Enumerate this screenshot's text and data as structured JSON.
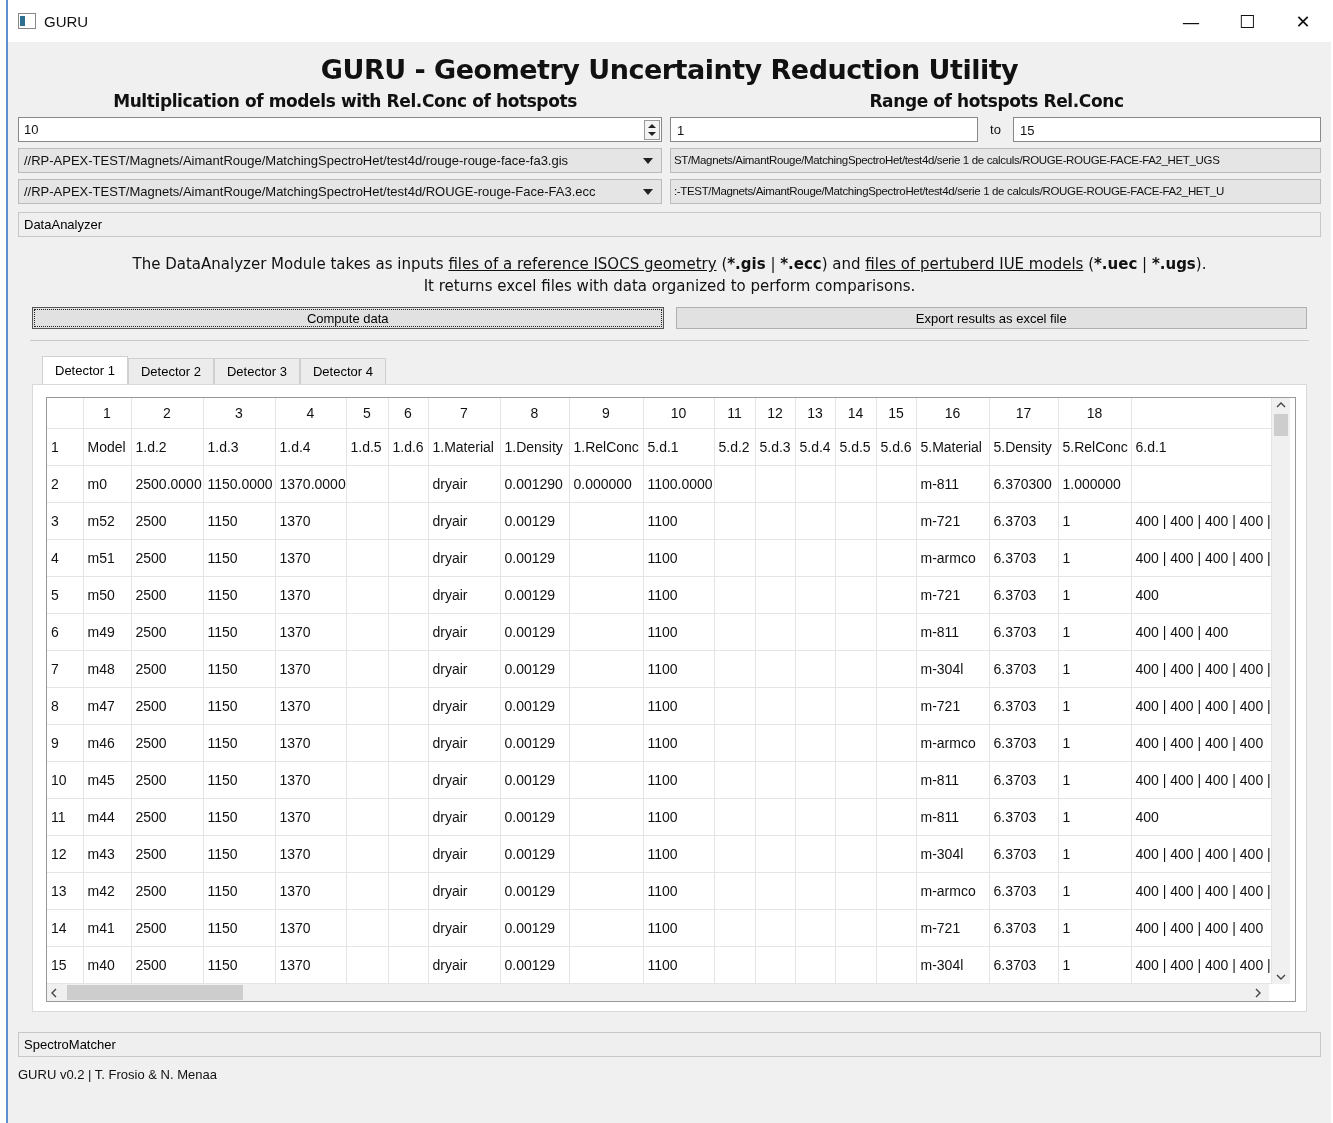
{
  "window": {
    "title": "GURU",
    "controls": [
      "—",
      "☐",
      "✕"
    ]
  },
  "app_title": "GURU -  Geometry Uncertainty Reduction Utility",
  "multiplication": {
    "heading": "Multiplication of models with Rel.Conc of hotspots",
    "value": "10"
  },
  "range": {
    "heading": "Range of hotspots Rel.Conc",
    "from": "1",
    "separator": "to",
    "to": "15"
  },
  "reference_files": [
    {
      "value": "//RP-APEX-TEST/Magnets/AimantRouge/MatchingSpectroHet/test4d/rouge-rouge-face-fa3.gis"
    },
    {
      "value": "//RP-APEX-TEST/Magnets/AimantRouge/MatchingSpectroHet/test4d/ROUGE-rouge-Face-FA3.ecc"
    }
  ],
  "model_files": [
    {
      "value": "ST/Magnets/AimantRouge/MatchingSpectroHet/test4d/serie 1 de calculs/ROUGE-ROUGE-FACE-FA2_HET_UGS"
    },
    {
      "value": ":-TEST/Magnets/AimantRouge/MatchingSpectroHet/test4d/serie 1 de calculs/ROUGE-ROUGE-FACE-FA2_HET_U"
    }
  ],
  "data_analyzer": {
    "section": "DataAnalyzer",
    "description": [
      [
        {
          "kind": "text",
          "text": "The DataAnalyzer Module takes as inputs "
        },
        {
          "kind": "link",
          "text": "files of a reference ISOCS geometry"
        },
        {
          "kind": "text",
          "text": " ("
        },
        {
          "kind": "bold",
          "text": "*.gis"
        },
        {
          "kind": "text",
          "text": " | "
        },
        {
          "kind": "bold",
          "text": "*.ecc"
        },
        {
          "kind": "text",
          "text": ") and "
        },
        {
          "kind": "link",
          "text": "files of pertuberd IUE models"
        },
        {
          "kind": "text",
          "text": " ("
        },
        {
          "kind": "bold",
          "text": "*.uec"
        },
        {
          "kind": "text",
          "text": " | "
        },
        {
          "kind": "bold",
          "text": "*.ugs"
        },
        {
          "kind": "text",
          "text": ")."
        }
      ],
      [
        {
          "kind": "text",
          "text": "It returns excel files with data organized to perform comparisons."
        }
      ]
    ],
    "buttons": [
      {
        "label": "Compute data",
        "focused": true
      },
      {
        "label": "Export results as excel file",
        "focused": false
      }
    ],
    "tabs": [
      {
        "label": "Detector 1",
        "selected": true
      },
      {
        "label": "Detector 2",
        "selected": false
      },
      {
        "label": "Detector 3",
        "selected": false
      },
      {
        "label": "Detector 4",
        "selected": false
      }
    ],
    "table": {
      "columns": [
        "1",
        "2",
        "3",
        "4",
        "5",
        "6",
        "7",
        "8",
        "9",
        "10",
        "11",
        "12",
        "13",
        "14",
        "15",
        "16",
        "17",
        "18"
      ],
      "rows": [
        {
          "label": "1",
          "cells": [
            "Model",
            "1.d.2",
            "1.d.3",
            "1.d.4",
            "1.d.5",
            "1.d.6",
            "1.Material",
            "1.Density",
            "1.RelConc",
            "5.d.1",
            "5.d.2",
            "5.d.3",
            "5.d.4",
            "5.d.5",
            "5.d.6",
            "5.Material",
            "5.Density",
            "5.RelConc",
            "6.d.1"
          ]
        },
        {
          "label": "2",
          "cells": [
            "m0",
            "2500.0000",
            "1150.0000",
            "1370.0000",
            null,
            null,
            "dryair",
            "0.001290",
            "0.000000",
            "1100.0000",
            null,
            null,
            null,
            null,
            null,
            "m-811",
            "6.370300",
            "1.000000",
            null
          ]
        },
        {
          "label": "3",
          "cells": [
            "m52",
            "2500",
            "1150",
            "1370",
            null,
            null,
            "dryair",
            "0.00129",
            null,
            "1100",
            null,
            null,
            null,
            null,
            null,
            "m-721",
            "6.3703",
            "1",
            "400 | 400 | 400 | 400 |"
          ]
        },
        {
          "label": "4",
          "cells": [
            "m51",
            "2500",
            "1150",
            "1370",
            null,
            null,
            "dryair",
            "0.00129",
            null,
            "1100",
            null,
            null,
            null,
            null,
            null,
            "m-armco",
            "6.3703",
            "1",
            "400 | 400 | 400 | 400 |"
          ]
        },
        {
          "label": "5",
          "cells": [
            "m50",
            "2500",
            "1150",
            "1370",
            null,
            null,
            "dryair",
            "0.00129",
            null,
            "1100",
            null,
            null,
            null,
            null,
            null,
            "m-721",
            "6.3703",
            "1",
            "400"
          ]
        },
        {
          "label": "6",
          "cells": [
            "m49",
            "2500",
            "1150",
            "1370",
            null,
            null,
            "dryair",
            "0.00129",
            null,
            "1100",
            null,
            null,
            null,
            null,
            null,
            "m-811",
            "6.3703",
            "1",
            "400 | 400 | 400"
          ]
        },
        {
          "label": "7",
          "cells": [
            "m48",
            "2500",
            "1150",
            "1370",
            null,
            null,
            "dryair",
            "0.00129",
            null,
            "1100",
            null,
            null,
            null,
            null,
            null,
            "m-304l",
            "6.3703",
            "1",
            "400 | 400 | 400 | 400 |"
          ]
        },
        {
          "label": "8",
          "cells": [
            "m47",
            "2500",
            "1150",
            "1370",
            null,
            null,
            "dryair",
            "0.00129",
            null,
            "1100",
            null,
            null,
            null,
            null,
            null,
            "m-721",
            "6.3703",
            "1",
            "400 | 400 | 400 | 400 |"
          ]
        },
        {
          "label": "9",
          "cells": [
            "m46",
            "2500",
            "1150",
            "1370",
            null,
            null,
            "dryair",
            "0.00129",
            null,
            "1100",
            null,
            null,
            null,
            null,
            null,
            "m-armco",
            "6.3703",
            "1",
            "400 | 400 | 400 | 400"
          ]
        },
        {
          "label": "10",
          "cells": [
            "m45",
            "2500",
            "1150",
            "1370",
            null,
            null,
            "dryair",
            "0.00129",
            null,
            "1100",
            null,
            null,
            null,
            null,
            null,
            "m-811",
            "6.3703",
            "1",
            "400 | 400 | 400 | 400 |"
          ]
        },
        {
          "label": "11",
          "cells": [
            "m44",
            "2500",
            "1150",
            "1370",
            null,
            null,
            "dryair",
            "0.00129",
            null,
            "1100",
            null,
            null,
            null,
            null,
            null,
            "m-811",
            "6.3703",
            "1",
            "400"
          ]
        },
        {
          "label": "12",
          "cells": [
            "m43",
            "2500",
            "1150",
            "1370",
            null,
            null,
            "dryair",
            "0.00129",
            null,
            "1100",
            null,
            null,
            null,
            null,
            null,
            "m-304l",
            "6.3703",
            "1",
            "400 | 400 | 400 | 400 |"
          ]
        },
        {
          "label": "13",
          "cells": [
            "m42",
            "2500",
            "1150",
            "1370",
            null,
            null,
            "dryair",
            "0.00129",
            null,
            "1100",
            null,
            null,
            null,
            null,
            null,
            "m-armco",
            "6.3703",
            "1",
            "400 | 400 | 400 | 400 |"
          ]
        },
        {
          "label": "14",
          "cells": [
            "m41",
            "2500",
            "1150",
            "1370",
            null,
            null,
            "dryair",
            "0.00129",
            null,
            "1100",
            null,
            null,
            null,
            null,
            null,
            "m-721",
            "6.3703",
            "1",
            "400 | 400 | 400 | 400"
          ]
        },
        {
          "label": "15",
          "cells": [
            "m40",
            "2500",
            "1150",
            "1370",
            null,
            null,
            "dryair",
            "0.00129",
            null,
            "1100",
            null,
            null,
            null,
            null,
            null,
            "m-304l",
            "6.3703",
            "1",
            "400 | 400 | 400 | 400 |"
          ]
        }
      ]
    }
  },
  "spectro_matcher": {
    "section": "SpectroMatcher"
  },
  "status_bar": "GURU v0.2 | T. Frosio & N. Menaa"
}
